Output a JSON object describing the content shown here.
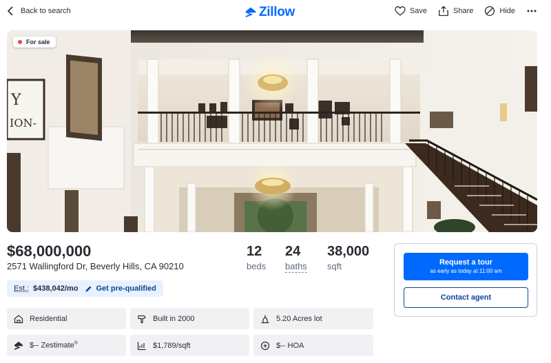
{
  "topbar": {
    "back_label": "Back to search",
    "logo_text": "Zillow",
    "save_label": "Save",
    "share_label": "Share",
    "hide_label": "Hide",
    "more_icon": "ellipsis-icon"
  },
  "hero": {
    "badge_label": "For sale",
    "badge_color": "#e5484d",
    "image_subject": "two-story white entry hall with gallery balcony, chandeliers and curved staircase"
  },
  "listing": {
    "price": "$68,000,000",
    "address": "2571 Wallingford Dr, Beverly Hills, CA 90210",
    "beds_value": "12",
    "beds_label": "beds",
    "baths_value": "24",
    "baths_label": "baths",
    "sqft_value": "38,000",
    "sqft_label": "sqft"
  },
  "estimate": {
    "label": "Est.:",
    "value": "$438,042/mo",
    "prequal_label": "Get pre-qualified"
  },
  "facts": [
    {
      "icon": "house-icon",
      "text": "Residential"
    },
    {
      "icon": "hammer-icon",
      "text": "Built in 2000"
    },
    {
      "icon": "lot-icon",
      "text": "5.20 Acres lot"
    },
    {
      "icon": "zestimate-icon",
      "text": "$-- Zestimate",
      "mark": "®"
    },
    {
      "icon": "price-chart-icon",
      "text": "$1,789/sqft"
    },
    {
      "icon": "hoa-icon",
      "text": "$-- HOA"
    }
  ],
  "contact": {
    "tour_label": "Request a tour",
    "tour_sub": "as early as today at 11:00 am",
    "agent_label": "Contact agent"
  },
  "colors": {
    "brand": "#006aff",
    "link": "#0d4599",
    "chip_bg": "#f1f1f4",
    "estimate_bg": "#e8f1ff"
  }
}
